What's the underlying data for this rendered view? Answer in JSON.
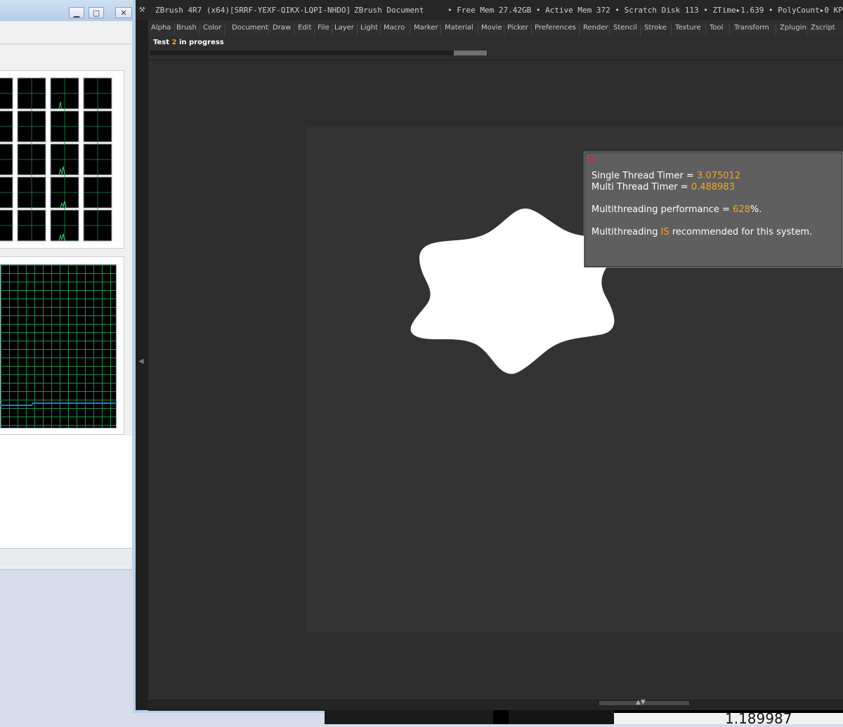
{
  "taskmgr": {
    "controls": [
      "□",
      "⊡",
      "✕"
    ]
  },
  "zbrush": {
    "title": "ZBrush 4R7 (x64)[SRRF-YEXF-QIKX-LQPI-NHDO]",
    "doc_label": "ZBrush Document",
    "status": "• Free Mem 27.42GB • Active Mem 372 • Scratch Disk 113 •  ZTime▸1.639 • PolyCount▸0  KP",
    "menu": [
      "Alpha",
      "Brush",
      "Color",
      "Document",
      "Draw",
      "Edit",
      "File",
      "Layer",
      "Light",
      "Macro",
      "Marker",
      "Material",
      "Movie",
      "Picker",
      "Preferences",
      "Render",
      "Stencil",
      "Stroke",
      "Texture",
      "Tool",
      "Transform",
      "Zplugin",
      "Zscript"
    ],
    "progress": {
      "prefix": "Test",
      "number": "2",
      "suffix": "in progress"
    },
    "popup": {
      "single_label": "Single Thread Timer = ",
      "single_value": "3.075012",
      "multi_label": "Multi Thread Timer = ",
      "multi_value": "0.488983",
      "perf_label": "Multithreading performance = ",
      "perf_value": "628",
      "perf_suffix": "%.",
      "rec_prefix": "Multithreading ",
      "rec_value": "IS",
      "rec_suffix": " recommended for this system."
    },
    "bottom_readout": "1.189987"
  },
  "colors": {
    "accent_orange": "#f5a623",
    "cpu_grid": "#1a8f4a",
    "cpu_line": "#2f6fe0"
  }
}
